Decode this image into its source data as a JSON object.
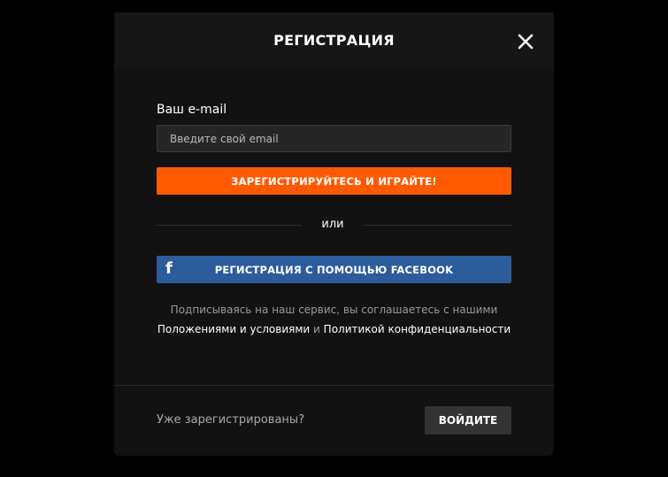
{
  "modal": {
    "title": "РЕГИСТРАЦИЯ",
    "close_icon": "close-icon"
  },
  "form": {
    "email_label": "Ваш e-mail",
    "email_placeholder": "Введите свой email",
    "email_value": "",
    "submit_label": "ЗАРЕГИСТРИРУЙТЕСЬ И ИГРАЙТЕ!",
    "divider_text": "или",
    "facebook_icon": "facebook-icon",
    "facebook_icon_glyph": "f",
    "facebook_label": "РЕГИСТРАЦИЯ С ПОМОЩЬЮ FACEBOOK"
  },
  "terms": {
    "prefix": "Подписываясь на наш сервис, вы соглашаетесь с нашими",
    "terms_link": "Положениями и условиями",
    "conjunction": "и",
    "privacy_link": "Политикой конфиденциальности"
  },
  "footer": {
    "question": "Уже зарегистрированы?",
    "login_label": "ВОЙДИТЕ"
  },
  "colors": {
    "page_background": "#000000",
    "modal_background": "#121212",
    "primary_accent": "#ff5a00",
    "facebook_blue": "#2d5c9d",
    "secondary_button": "#333333"
  }
}
